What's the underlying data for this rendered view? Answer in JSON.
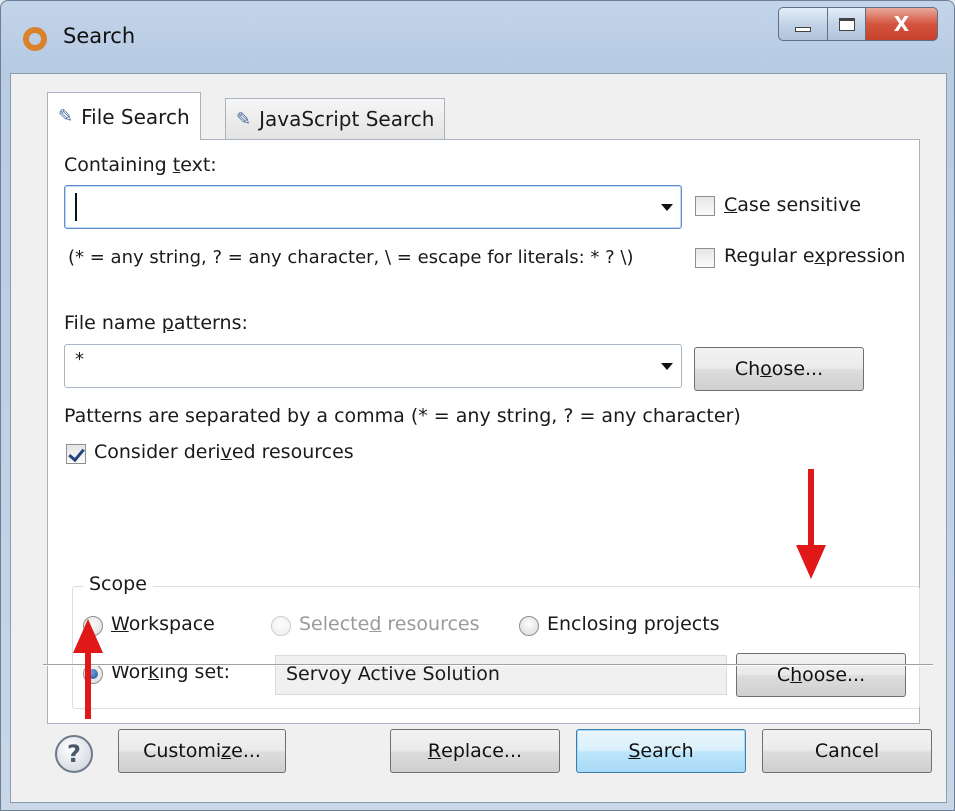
{
  "window": {
    "title": "Search",
    "close_glyph": "X"
  },
  "tabs": [
    {
      "label": "File Search",
      "icon": "file-search-icon",
      "active": true
    },
    {
      "label": "JavaScript Search",
      "icon": "javascript-search-icon",
      "active": false
    }
  ],
  "containing_text": {
    "label_before": "Containing ",
    "label_mnemonic": "t",
    "label_after": "ext:",
    "value": "",
    "hint": "(* = any string, ? = any character, \\ = escape for literals: * ? \\)",
    "case_sensitive": {
      "mnemonic": "C",
      "label_rest": "ase sensitive",
      "checked": false
    },
    "regex": {
      "label_before": "Regular e",
      "mnemonic": "x",
      "label_after": "pression",
      "checked": false
    }
  },
  "file_name_patterns": {
    "label_before": "File name ",
    "label_mnemonic": "p",
    "label_after": "atterns:",
    "value": "*",
    "choose_before": "Ch",
    "choose_mnemonic": "o",
    "choose_after": "ose...",
    "hint": "Patterns are separated by a comma (* = any string, ? = any character)"
  },
  "derived": {
    "label_before": "Consider deri",
    "mnemonic": "v",
    "label_after": "ed resources",
    "checked": true
  },
  "scope": {
    "title": "Scope",
    "workspace": {
      "mnemonic": "W",
      "label_rest": "orkspace",
      "checked": false
    },
    "selected": {
      "label_before": "Selecte",
      "mnemonic": "d",
      "label_after": " resources",
      "disabled": true
    },
    "enclosing": {
      "label": "Enclosing projects",
      "checked": false
    },
    "working_set": {
      "label_before": "Wor",
      "mnemonic": "k",
      "label_after": "ing set:",
      "checked": true
    },
    "working_set_value": "Servoy Active Solution",
    "choose_before": "C",
    "choose_mnemonic": "h",
    "choose_after": "oose..."
  },
  "buttons": {
    "customize_before": "Customi",
    "customize_mnemonic": "z",
    "customize_after": "e...",
    "replace_mnemonic": "R",
    "replace_rest": "eplace...",
    "search_mnemonic": "S",
    "search_rest": "earch",
    "cancel": "Cancel",
    "help": "?"
  },
  "colors": {
    "annotation_arrow": "#e01818",
    "title_bar": "#b7cbe3",
    "default_button": "#3c7fb1"
  }
}
